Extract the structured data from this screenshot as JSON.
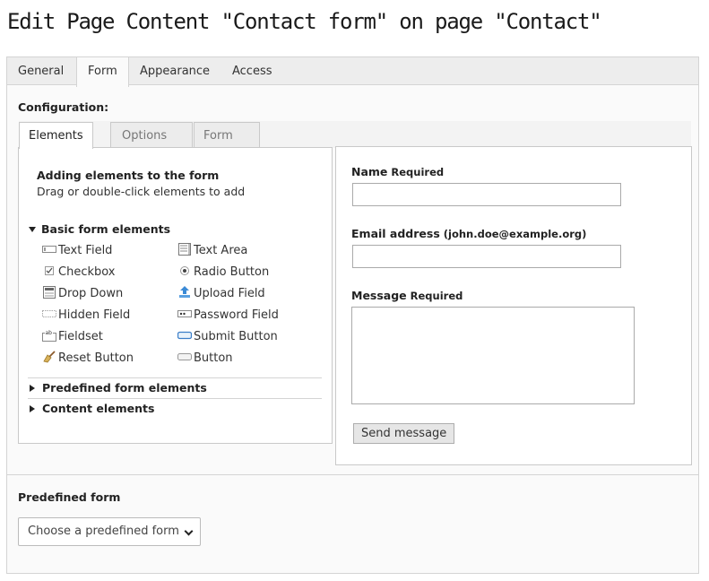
{
  "page_title": "Edit Page Content \"Contact form\" on page \"Contact\"",
  "main_tabs": [
    "General",
    "Form",
    "Appearance",
    "Access"
  ],
  "configuration_label": "Configuration:",
  "inner_tabs": [
    "Elements",
    "Options",
    "Form"
  ],
  "elements_panel": {
    "heading": "Adding elements to the form",
    "hint": "Drag or double-click elements to add",
    "basic_section": "Basic form elements",
    "basic_items": [
      "Text Field",
      "Text Area",
      "Checkbox",
      "Radio Button",
      "Drop Down",
      "Upload Field",
      "Hidden Field",
      "Password Field",
      "Fieldset",
      "Submit Button",
      "Reset Button",
      "Button"
    ],
    "predefined_section": "Predefined form elements",
    "content_section": "Content elements"
  },
  "preview": {
    "name_label": "Name",
    "name_required": "Required",
    "email_label": "Email address",
    "email_hint": "(john.doe@example.org)",
    "message_label": "Message",
    "message_required": "Required",
    "send_button": "Send message"
  },
  "predefined": {
    "label": "Predefined form",
    "select_value": "Choose a predefined form"
  }
}
